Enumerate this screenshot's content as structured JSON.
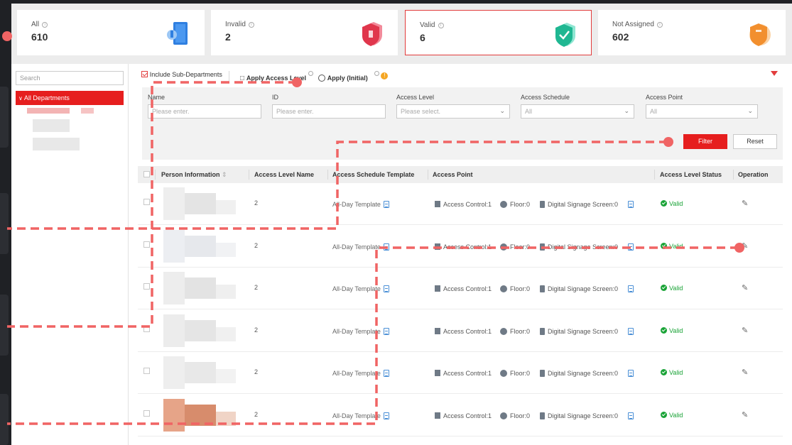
{
  "stats": [
    {
      "label": "All",
      "value": "610",
      "icon": "door-icon",
      "accent": "#3a8be8"
    },
    {
      "label": "Invalid",
      "value": "2",
      "icon": "invalid-shield-icon",
      "accent": "#e84a5f"
    },
    {
      "label": "Valid",
      "value": "6",
      "icon": "valid-shield-icon",
      "accent": "#22c4a4"
    },
    {
      "label": "Not Assigned",
      "value": "602",
      "icon": "unassigned-shield-icon",
      "accent": "#f49a3a"
    }
  ],
  "tree": {
    "search_placeholder": "Search",
    "root_label": "All Departments"
  },
  "toolbar": {
    "include_sub": "Include Sub-Departments",
    "apply_level": "Apply Access Level",
    "apply_initial": "Apply (Initial)"
  },
  "filters": {
    "name_label": "Name",
    "name_placeholder": "Please enter.",
    "id_label": "ID",
    "id_placeholder": "Please enter.",
    "level_label": "Access Level",
    "level_placeholder": "Please select.",
    "schedule_label": "Access Schedule",
    "schedule_value": "All",
    "point_label": "Access Point",
    "point_value": "All",
    "filter_button": "Filter",
    "reset_button": "Reset"
  },
  "table": {
    "columns": {
      "person": "Person Information",
      "level": "Access Level Name",
      "schedule": "Access Schedule Template",
      "point": "Access Point",
      "status": "Access Level Status",
      "operation": "Operation"
    },
    "rows": [
      {
        "level": "2",
        "schedule": "All-Day Template",
        "ac": "Access Control:1",
        "floor": "Floor:0",
        "screen": "Digital Signage Screen:0",
        "status": "Valid"
      },
      {
        "level": "2",
        "schedule": "All-Day Template",
        "ac": "Access Control:1",
        "floor": "Floor:0",
        "screen": "Digital Signage Screen:0",
        "status": "Valid"
      },
      {
        "level": "2",
        "schedule": "All-Day Template",
        "ac": "Access Control:1",
        "floor": "Floor:0",
        "screen": "Digital Signage Screen:0",
        "status": "Valid"
      },
      {
        "level": "2",
        "schedule": "All-Day Template",
        "ac": "Access Control:1",
        "floor": "Floor:0",
        "screen": "Digital Signage Screen:0",
        "status": "Valid"
      },
      {
        "level": "2",
        "schedule": "All-Day Template",
        "ac": "Access Control:1",
        "floor": "Floor:0",
        "screen": "Digital Signage Screen:0",
        "status": "Valid"
      },
      {
        "level": "2",
        "schedule": "All-Day Template",
        "ac": "Access Control:1",
        "floor": "Floor:0",
        "screen": "Digital Signage Screen:0",
        "status": "Valid"
      }
    ]
  },
  "colors": {
    "brand_red": "#e61e1e",
    "valid_green": "#19a336",
    "annotation": "#f06464"
  }
}
